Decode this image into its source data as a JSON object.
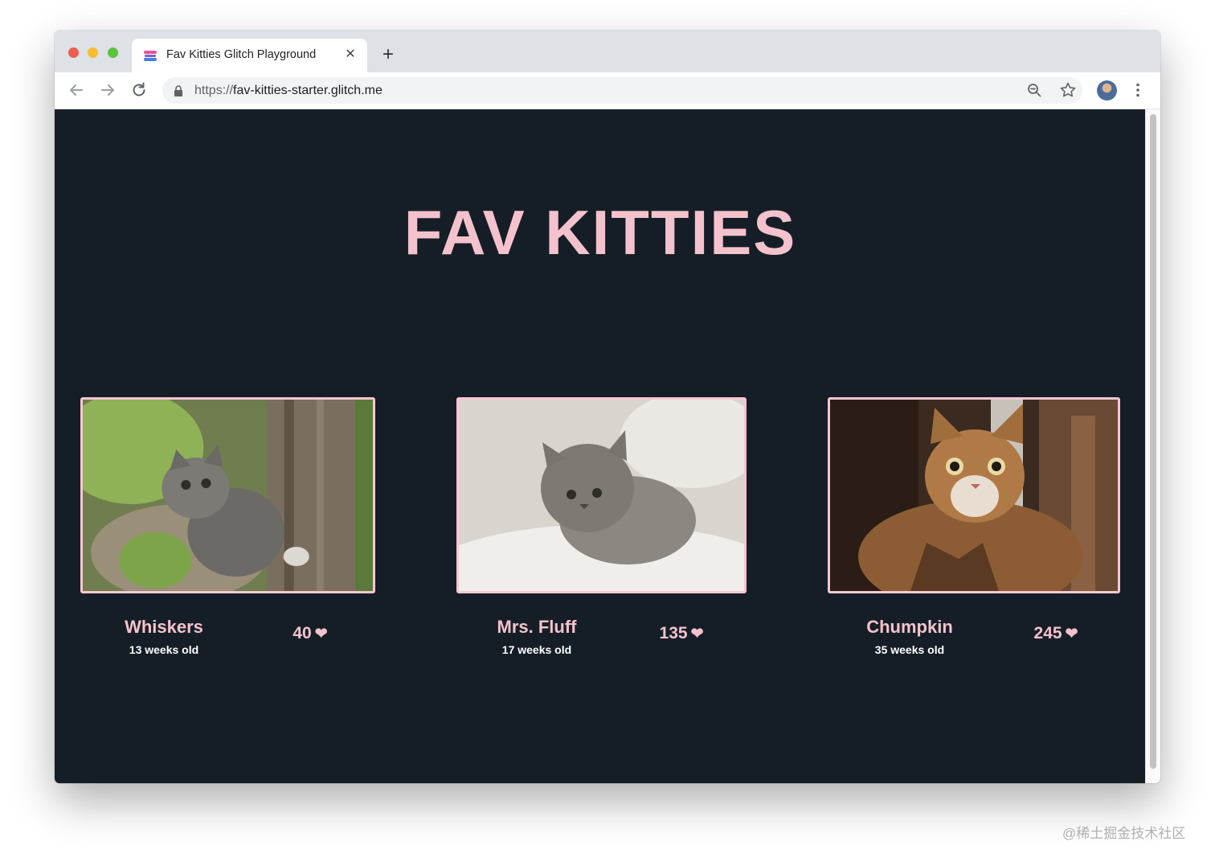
{
  "browser": {
    "tab_title": "Fav Kitties Glitch Playground",
    "close_glyph": "✕",
    "new_tab_glyph": "+",
    "url_scheme": "https://",
    "url_host": "fav-kitties-starter.glitch.me"
  },
  "page": {
    "title": "FAV KITTIES",
    "background": "#151e27",
    "accent": "#f4c2cc"
  },
  "kitties": [
    {
      "name": "Whiskers",
      "age": "13 weeks old",
      "likes": "40",
      "heart": "❤"
    },
    {
      "name": "Mrs. Fluff",
      "age": "17 weeks old",
      "likes": "135",
      "heart": "❤"
    },
    {
      "name": "Chumpkin",
      "age": "35 weeks old",
      "likes": "245",
      "heart": "❤"
    }
  ],
  "watermark": "@稀土掘金技术社区"
}
